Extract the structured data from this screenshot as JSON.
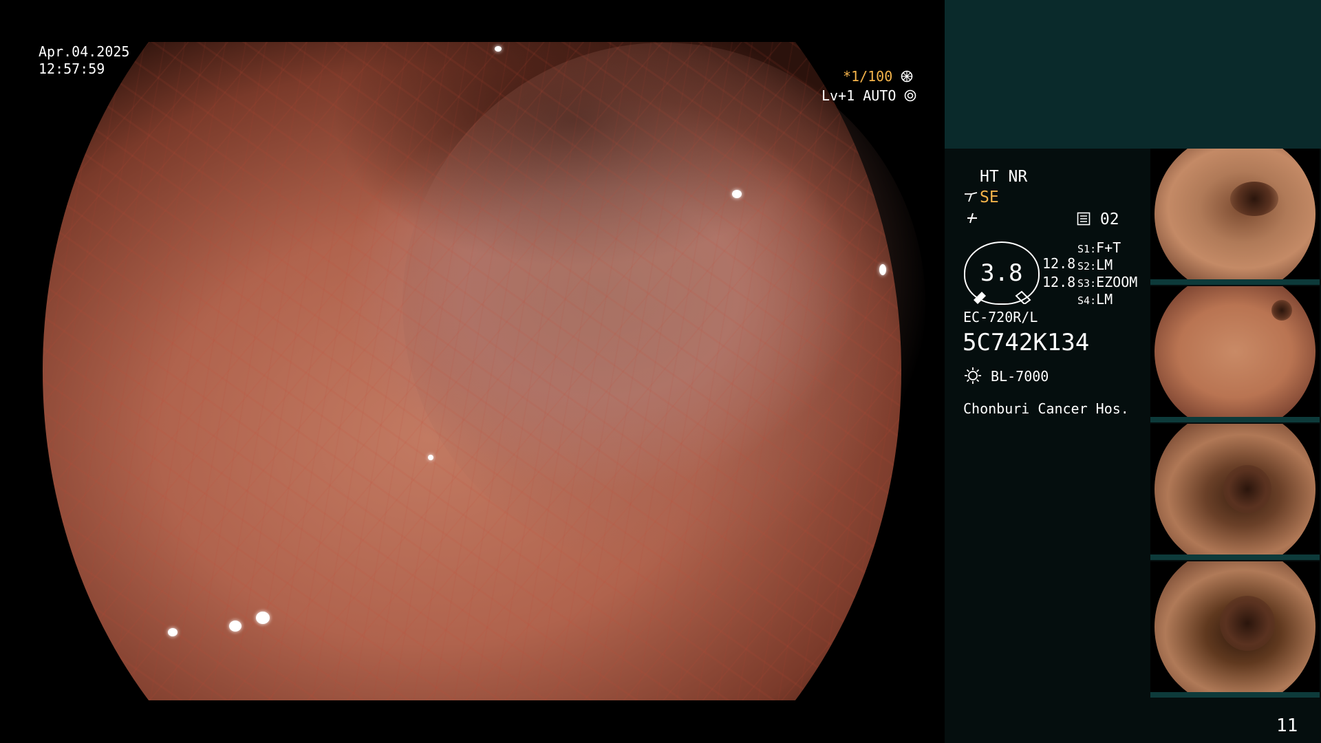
{
  "osd": {
    "date": "Apr.04.2025",
    "time": "12:57:59",
    "shutter": "*1/100",
    "shutter_icon": "aperture-icon",
    "level": "Lv+1 AUTO",
    "level_icon": "iris-icon"
  },
  "panel": {
    "mode": "HT NR",
    "structure_enhance": "SE",
    "structure_icon": "structure-enhance-icon",
    "color_icon": "color-enhance-icon",
    "memo_icon": "memo-icon",
    "memo_value": "02",
    "gauge_value": "3.8",
    "scale_values": [
      "12.8",
      "12.8"
    ],
    "switches": [
      {
        "key": "S1",
        "value": "F+T"
      },
      {
        "key": "S2",
        "value": "LM"
      },
      {
        "key": "S3",
        "value": "EZOOM"
      },
      {
        "key": "S4",
        "value": "LM"
      }
    ],
    "scope_model": "EC-720R/L",
    "serial": "5C742K134",
    "light_source_icon": "light-source-icon",
    "light_source": "BL-7000",
    "hospital": "Chonburi Cancer Hos.",
    "page_number": "11"
  },
  "colors": {
    "accent": "#f4b34a",
    "panel_top": "#0a2a2b",
    "panel_bottom": "#050e0e",
    "thumb_border": "#0d3a3a"
  }
}
